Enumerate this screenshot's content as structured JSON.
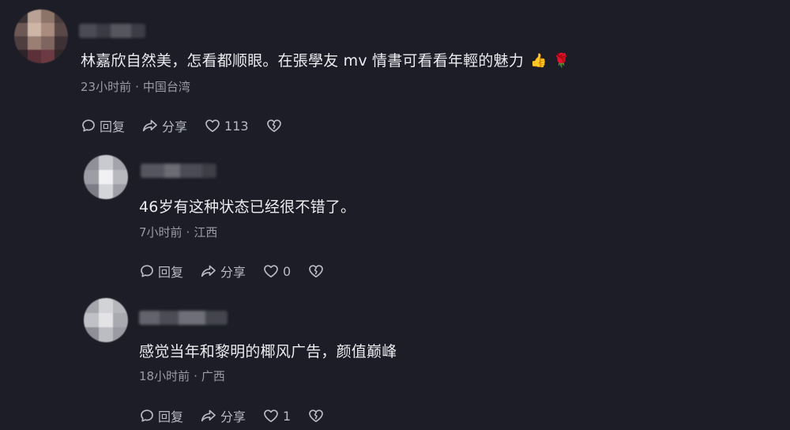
{
  "colors": {
    "background": "#1c1d26",
    "text": "#ececf0",
    "meta": "#9a9ba6",
    "action": "#b9bac4"
  },
  "comments": [
    {
      "text": "林嘉欣自然美，怎看都顺眼。在張學友 mv 情書可看看年輕的魅力",
      "emojis": [
        "👍",
        "🌹"
      ],
      "time": "23小时前",
      "location": "中国台湾",
      "reply_label": "回复",
      "share_label": "分享",
      "likes": "113"
    },
    {
      "text": "46岁有这种状态已经很不错了。",
      "time": "7小时前",
      "location": "江西",
      "reply_label": "回复",
      "share_label": "分享",
      "likes": "0"
    },
    {
      "text": "感觉当年和黎明的椰风广告，颜值巅峰",
      "time": "18小时前",
      "location": "广西",
      "reply_label": "回复",
      "share_label": "分享",
      "likes": "1"
    }
  ],
  "separator": "·"
}
